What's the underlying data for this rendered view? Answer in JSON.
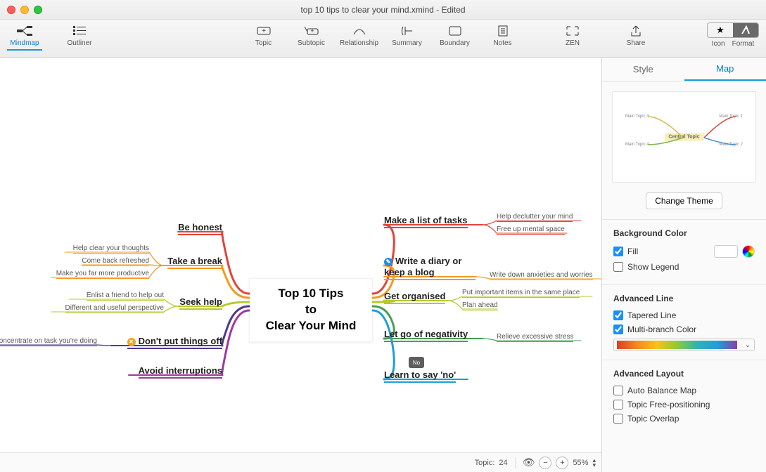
{
  "window": {
    "title": "top 10 tips to clear your mind.xmind - Edited"
  },
  "toolbar": {
    "left": [
      {
        "label": "Mindmap",
        "icon": "mindmap",
        "active": true
      },
      {
        "label": "Outliner",
        "icon": "outliner",
        "active": false
      }
    ],
    "center": [
      {
        "label": "Topic",
        "icon": "topic"
      },
      {
        "label": "Subtopic",
        "icon": "subtopic"
      },
      {
        "label": "Relationship",
        "icon": "relationship"
      },
      {
        "label": "Summary",
        "icon": "summary"
      },
      {
        "label": "Boundary",
        "icon": "boundary"
      },
      {
        "label": "Notes",
        "icon": "notes"
      }
    ],
    "right1": [
      {
        "label": "ZEN",
        "icon": "zen"
      },
      {
        "label": "Share",
        "icon": "share"
      }
    ],
    "segment": {
      "icon_label": "Icon",
      "format_label": "Format",
      "active": "Format"
    }
  },
  "mindmap": {
    "center": "Top 10 Tips\nto\nClear Your Mind",
    "left": [
      {
        "label": "Be honest",
        "color": "#e3443a",
        "subs": []
      },
      {
        "label": "Take a break",
        "color": "#f29a1f",
        "subs": [
          "Help clear your thoughts",
          "Come back refreshed",
          "Make you far more productive"
        ]
      },
      {
        "label": "Seek help",
        "color": "#b7c92b",
        "subs": [
          "Enlist a friend to help out",
          "Different and useful perspective"
        ]
      },
      {
        "label": "Don't put things off",
        "color": "#4f3a8f",
        "marker": {
          "bg": "#f2a21e",
          "text": "✕"
        },
        "subs": [
          "Concentrate on task you're doing"
        ]
      },
      {
        "label": "Avoid interruptions",
        "color": "#9b3a9b",
        "subs": []
      }
    ],
    "right": [
      {
        "label": "Make a list of tasks",
        "color": "#e3443a",
        "subs": [
          "Help declutter your mind",
          "Free up mental space"
        ]
      },
      {
        "label": "Write a diary or keep a blog",
        "color": "#f29a1f",
        "marker": {
          "bg": "#1f8fe0",
          "text": "✎"
        },
        "wrap": true,
        "subs": [
          "Write down anxieties and worries"
        ]
      },
      {
        "label": "Get organised",
        "color": "#b7c92b",
        "subs": [
          "Put important items in the same place",
          "Plan ahead"
        ]
      },
      {
        "label": "Let go of negativity",
        "color": "#47a053",
        "subs": [
          "Relieve excessive stress"
        ]
      },
      {
        "label": "Learn to say 'no'",
        "color": "#1f9ed8",
        "badge": "No",
        "subs": []
      }
    ]
  },
  "sidebar": {
    "tabs": {
      "style": "Style",
      "map": "Map",
      "active": "Map"
    },
    "preview_center": "Central Topic",
    "change_theme": "Change Theme",
    "bgcolor": {
      "title": "Background Color",
      "fill_label": "Fill",
      "fill": true,
      "swatch": "#ffffff",
      "show_legend_label": "Show Legend",
      "show_legend": false
    },
    "advline": {
      "title": "Advanced Line",
      "tapered_label": "Tapered Line",
      "tapered": true,
      "multi_label": "Multi-branch Color",
      "multi": true
    },
    "advlayout": {
      "title": "Advanced Layout",
      "auto_label": "Auto Balance Map",
      "auto": false,
      "free_label": "Topic Free-positioning",
      "free": false,
      "overlap_label": "Topic Overlap",
      "overlap": false
    }
  },
  "status": {
    "topic_label": "Topic:",
    "topic_count": "24",
    "zoom": "55%"
  }
}
